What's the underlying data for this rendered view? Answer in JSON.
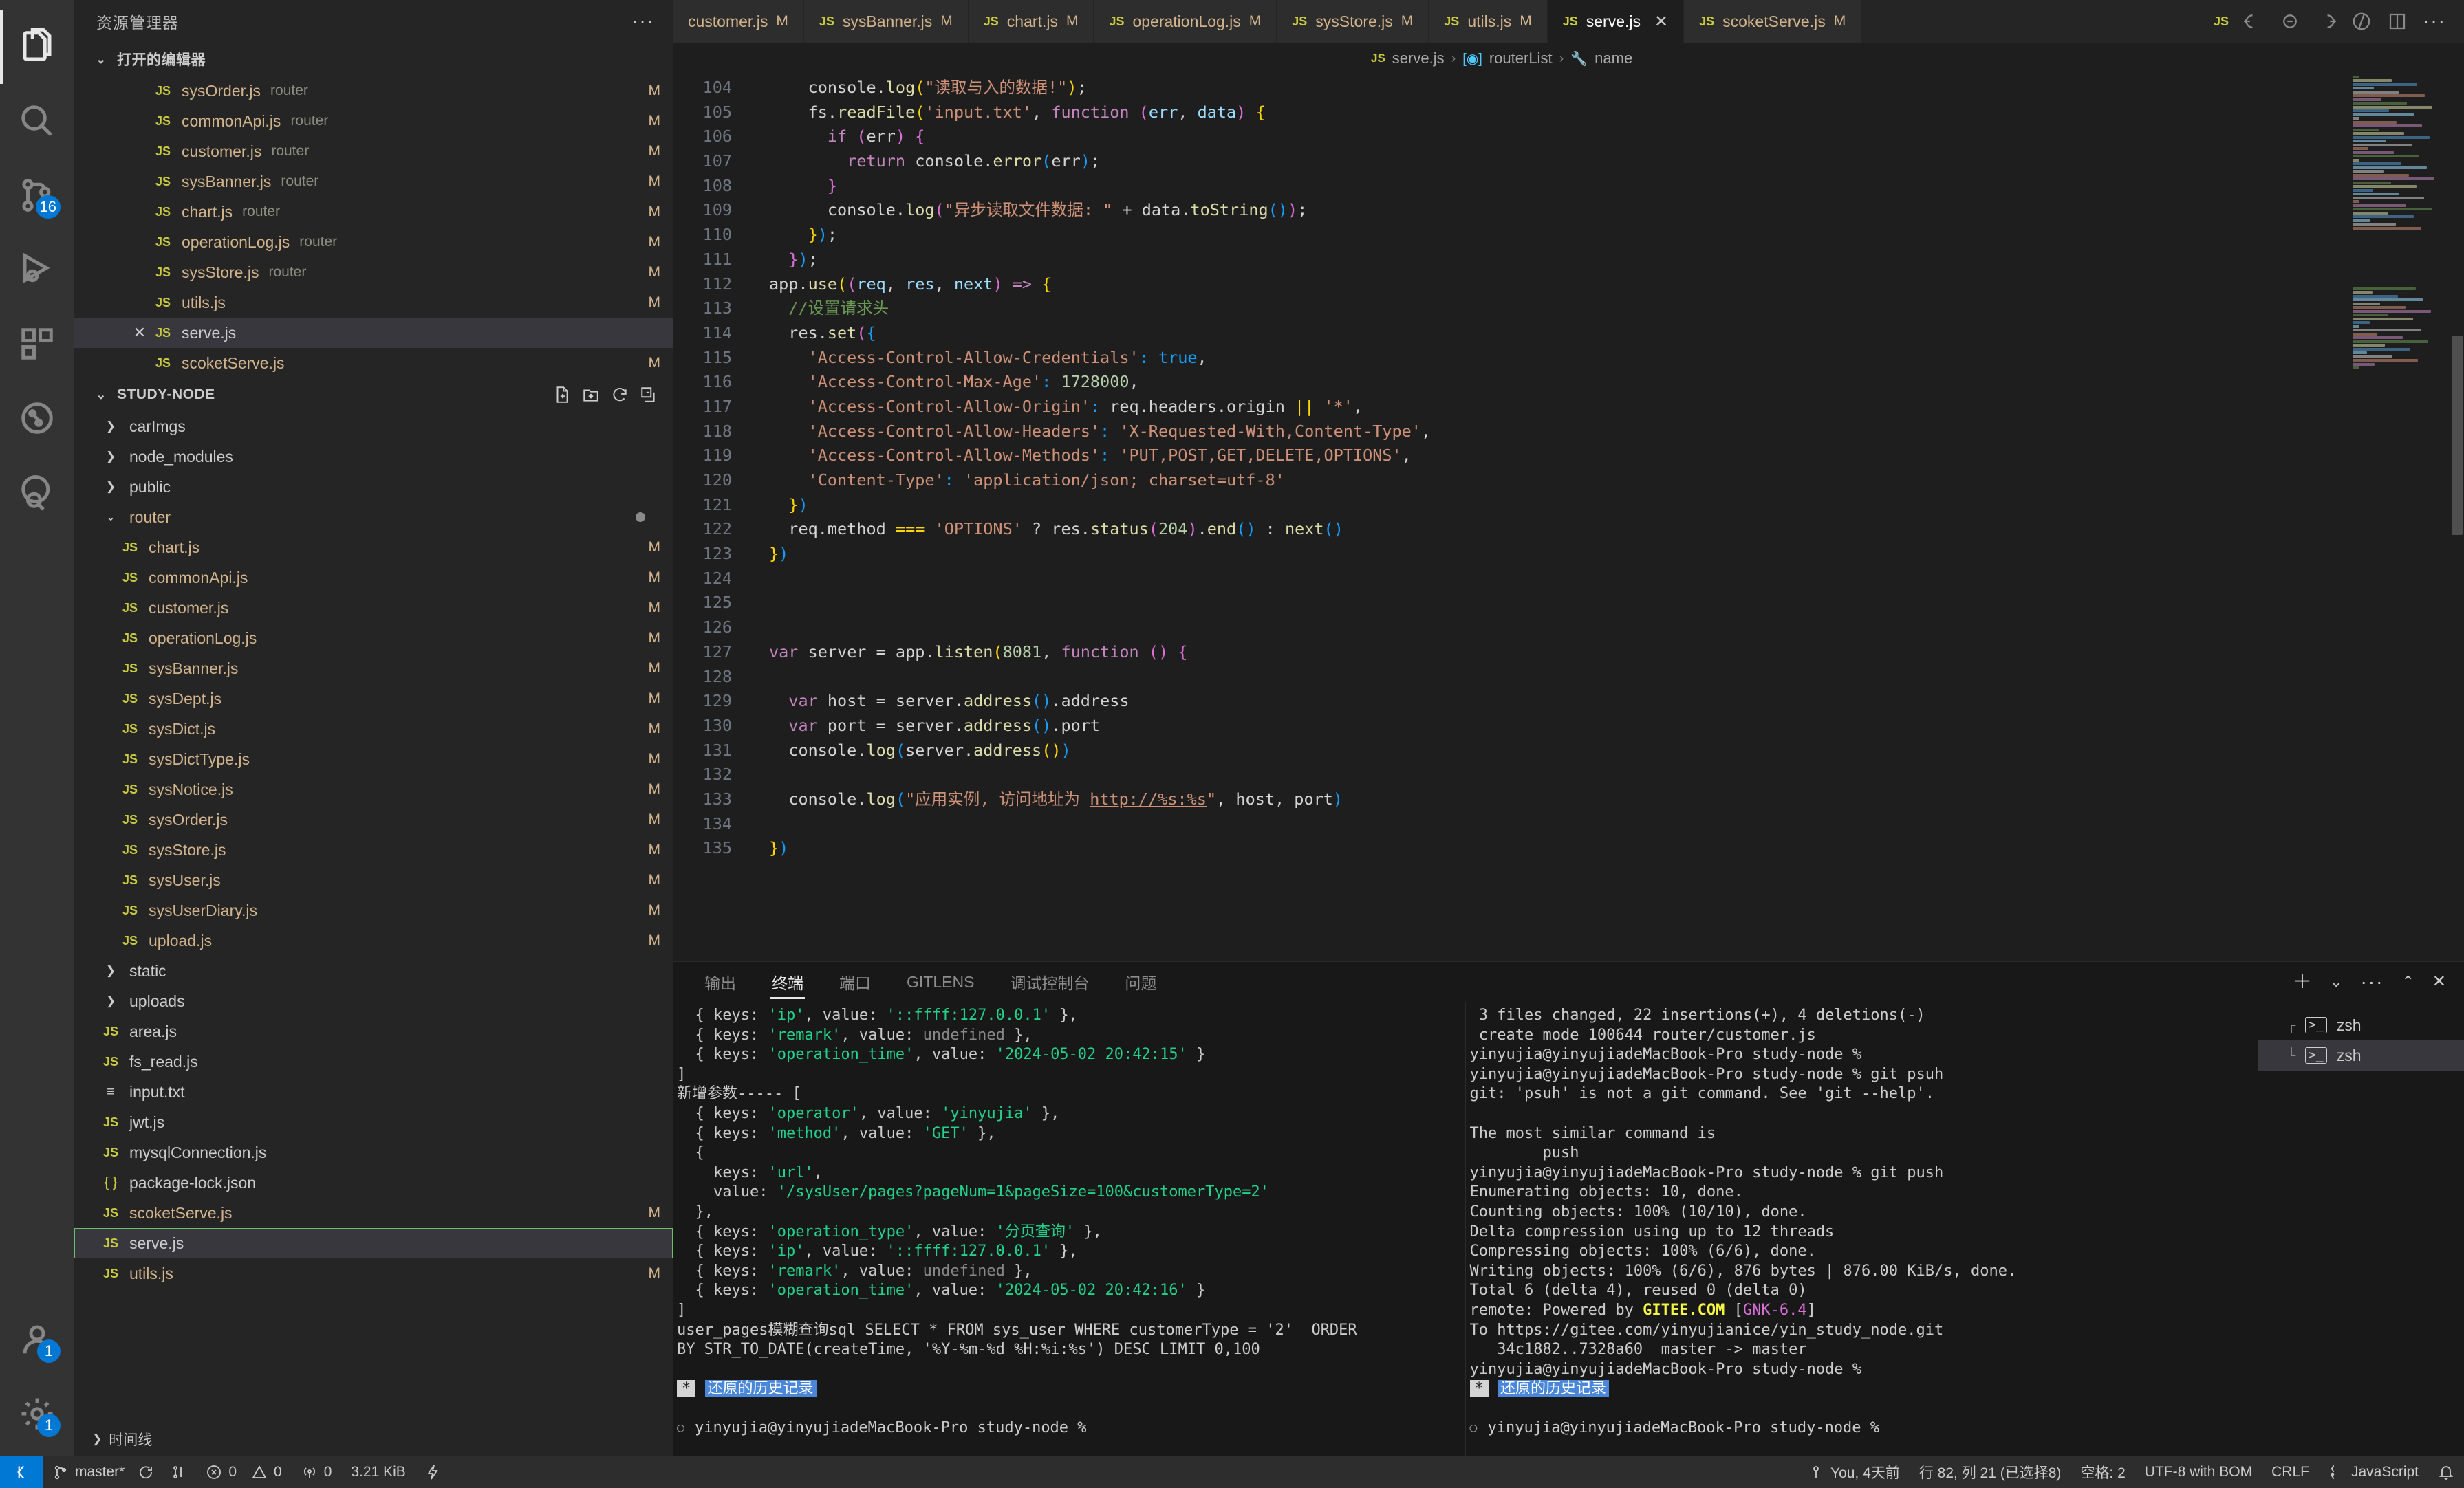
{
  "activity_bar": {
    "items": [
      {
        "name": "explorer",
        "icon": "files-icon",
        "active": true,
        "badge": null
      },
      {
        "name": "search",
        "icon": "search-icon",
        "active": false,
        "badge": null
      },
      {
        "name": "source-control",
        "icon": "source-control-icon",
        "active": false,
        "badge": "16"
      },
      {
        "name": "run-and-debug",
        "icon": "run-debug-icon",
        "active": false,
        "badge": null
      },
      {
        "name": "extensions",
        "icon": "extensions-icon",
        "active": false,
        "badge": null
      },
      {
        "name": "testing",
        "icon": "beaker-icon",
        "active": false,
        "badge": null
      },
      {
        "name": "gitlens",
        "icon": "gitlens-icon",
        "active": false,
        "badge": null
      }
    ],
    "bottom": [
      {
        "name": "accounts",
        "icon": "account-icon",
        "badge": "1"
      },
      {
        "name": "manage",
        "icon": "gear-icon",
        "badge": "1"
      }
    ]
  },
  "sidebar": {
    "title": "资源管理器",
    "more_label": "···",
    "open_editors": {
      "label": "打开的编辑器",
      "items": [
        {
          "name": "sysOrder.js",
          "desc": "router",
          "mod": "M",
          "active": false
        },
        {
          "name": "commonApi.js",
          "desc": "router",
          "mod": "M",
          "active": false
        },
        {
          "name": "customer.js",
          "desc": "router",
          "mod": "M",
          "active": false
        },
        {
          "name": "sysBanner.js",
          "desc": "router",
          "mod": "M",
          "active": false
        },
        {
          "name": "chart.js",
          "desc": "router",
          "mod": "M",
          "active": false
        },
        {
          "name": "operationLog.js",
          "desc": "router",
          "mod": "M",
          "active": false
        },
        {
          "name": "sysStore.js",
          "desc": "router",
          "mod": "M",
          "active": false
        },
        {
          "name": "utils.js",
          "desc": "",
          "mod": "M",
          "active": false
        },
        {
          "name": "serve.js",
          "desc": "",
          "mod": "",
          "active": true
        },
        {
          "name": "scoketServe.js",
          "desc": "",
          "mod": "M",
          "active": false
        }
      ]
    },
    "workspace": {
      "label": "STUDY-NODE",
      "actions": [
        "new-file-icon",
        "new-folder-icon",
        "refresh-icon",
        "collapse-all-icon"
      ],
      "tree": [
        {
          "type": "folder",
          "name": "carImgs",
          "expanded": false,
          "indent": 1,
          "mod": ""
        },
        {
          "type": "folder",
          "name": "node_modules",
          "expanded": false,
          "indent": 1,
          "mod": ""
        },
        {
          "type": "folder",
          "name": "public",
          "expanded": false,
          "indent": 1,
          "mod": ""
        },
        {
          "type": "folder",
          "name": "router",
          "expanded": true,
          "indent": 1,
          "mod": "",
          "dirty": true,
          "color": "mod-js"
        },
        {
          "type": "js",
          "name": "chart.js",
          "indent": 2,
          "mod": "M",
          "color": "mod-js"
        },
        {
          "type": "js",
          "name": "commonApi.js",
          "indent": 2,
          "mod": "M",
          "color": "mod-js"
        },
        {
          "type": "js",
          "name": "customer.js",
          "indent": 2,
          "mod": "M",
          "color": "mod-js"
        },
        {
          "type": "js",
          "name": "operationLog.js",
          "indent": 2,
          "mod": "M",
          "color": "mod-js"
        },
        {
          "type": "js",
          "name": "sysBanner.js",
          "indent": 2,
          "mod": "M",
          "color": "mod-js"
        },
        {
          "type": "js",
          "name": "sysDept.js",
          "indent": 2,
          "mod": "M",
          "color": "mod-js"
        },
        {
          "type": "js",
          "name": "sysDict.js",
          "indent": 2,
          "mod": "M",
          "color": "mod-js"
        },
        {
          "type": "js",
          "name": "sysDictType.js",
          "indent": 2,
          "mod": "M",
          "color": "mod-js"
        },
        {
          "type": "js",
          "name": "sysNotice.js",
          "indent": 2,
          "mod": "M",
          "color": "mod-js"
        },
        {
          "type": "js",
          "name": "sysOrder.js",
          "indent": 2,
          "mod": "M",
          "color": "mod-js"
        },
        {
          "type": "js",
          "name": "sysStore.js",
          "indent": 2,
          "mod": "M",
          "color": "mod-js"
        },
        {
          "type": "js",
          "name": "sysUser.js",
          "indent": 2,
          "mod": "M",
          "color": "mod-js"
        },
        {
          "type": "js",
          "name": "sysUserDiary.js",
          "indent": 2,
          "mod": "M",
          "color": "mod-js"
        },
        {
          "type": "js",
          "name": "upload.js",
          "indent": 2,
          "mod": "M",
          "color": "mod-js"
        },
        {
          "type": "folder",
          "name": "static",
          "expanded": false,
          "indent": 1,
          "mod": ""
        },
        {
          "type": "folder",
          "name": "uploads",
          "expanded": false,
          "indent": 1,
          "mod": ""
        },
        {
          "type": "js",
          "name": "area.js",
          "indent": 1,
          "mod": "",
          "color": "plain"
        },
        {
          "type": "js",
          "name": "fs_read.js",
          "indent": 1,
          "mod": "",
          "color": "plain"
        },
        {
          "type": "txt",
          "name": "input.txt",
          "indent": 1,
          "mod": "",
          "color": "plain"
        },
        {
          "type": "js",
          "name": "jwt.js",
          "indent": 1,
          "mod": "",
          "color": "plain"
        },
        {
          "type": "js",
          "name": "mysqlConnection.js",
          "indent": 1,
          "mod": "",
          "color": "plain"
        },
        {
          "type": "json",
          "name": "package-lock.json",
          "indent": 1,
          "mod": "",
          "color": "plain"
        },
        {
          "type": "js",
          "name": "scoketServe.js",
          "indent": 1,
          "mod": "M",
          "color": "mod-js"
        },
        {
          "type": "js",
          "name": "serve.js",
          "indent": 1,
          "mod": "",
          "color": "plain",
          "focused": true
        },
        {
          "type": "js",
          "name": "utils.js",
          "indent": 1,
          "mod": "M",
          "color": "mod-js"
        }
      ]
    },
    "timeline_label": "时间线"
  },
  "editor": {
    "tabs": [
      {
        "name": "customer.js",
        "mod": "M",
        "active": false,
        "show_icon": false
      },
      {
        "name": "sysBanner.js",
        "mod": "M",
        "active": false,
        "show_icon": true
      },
      {
        "name": "chart.js",
        "mod": "M",
        "active": false,
        "show_icon": true
      },
      {
        "name": "operationLog.js",
        "mod": "M",
        "active": false,
        "show_icon": true
      },
      {
        "name": "sysStore.js",
        "mod": "M",
        "active": false,
        "show_icon": true
      },
      {
        "name": "utils.js",
        "mod": "M",
        "active": false,
        "show_icon": true
      },
      {
        "name": "serve.js",
        "mod": "",
        "active": true,
        "show_icon": true,
        "close": "✕"
      },
      {
        "name": "scoketServe.js",
        "mod": "M",
        "active": false,
        "show_icon": true
      }
    ],
    "tab_actions": [
      "split-left-icon",
      "split-center-icon",
      "split-right-icon",
      "run-icon",
      "split-editor-icon",
      "more-icon"
    ],
    "breadcrumb": {
      "file": "serve.js",
      "symbol1": "routerList",
      "symbol2": "name",
      "separator": "›"
    },
    "code_lines": [
      {
        "n": 104,
        "html": "    console.<span class='fn'>log</span><span class='pp'>(</span><span class='st'>\"读取与入的数据!\"</span><span class='pp'>)</span>;"
      },
      {
        "n": 105,
        "html": "    fs.<span class='fn'>readFile</span><span class='pp'>(</span><span class='st'>'input.txt'</span>, <span class='kw'>function</span> <span class='p2'>(</span><span class='vr'>err</span>, <span class='vr'>data</span><span class='p2'>)</span> <span class='pp'>{</span>"
      },
      {
        "n": 106,
        "html": "      <span class='kw'>if</span> <span class='p2'>(</span>err<span class='p2'>)</span> <span class='p2'>{</span>"
      },
      {
        "n": 107,
        "html": "        <span class='kw'>return</span> console.<span class='fn'>error</span><span class='p3'>(</span>err<span class='p3'>)</span>;"
      },
      {
        "n": 108,
        "html": "      <span class='p2'>}</span>"
      },
      {
        "n": 109,
        "html": "      console.<span class='fn'>log</span><span class='p2'>(</span><span class='st'>\"异步读取文件数据: \"</span> + data.<span class='fn'>toString</span><span class='p3'>()</span><span class='p2'>)</span>;"
      },
      {
        "n": 110,
        "html": "    <span class='pp'>}</span><span class='p3'>)</span>;"
      },
      {
        "n": 111,
        "html": "  <span class='p2'>}</span><span class='p3'>)</span>;"
      },
      {
        "n": 112,
        "html": "app.<span class='fn'>use</span><span class='pp'>(</span><span class='p2'>(</span><span class='vr'>req</span>, <span class='vr'>res</span>, <span class='vr'>next</span><span class='p2'>)</span> <span class='kw'>=&gt;</span> <span class='pp'>{</span>"
      },
      {
        "n": 113,
        "html": "  <span class='cm'>//设置请求头</span>"
      },
      {
        "n": 114,
        "html": "  res.<span class='fn'>set</span><span class='p2'>(</span><span class='p3'>{</span>"
      },
      {
        "n": 115,
        "html": "    <span class='st'>'Access-Control-Allow-Credentials'</span><span class='p3'>:</span> <span class='p3'>true</span>,"
      },
      {
        "n": 116,
        "html": "    <span class='st'>'Access-Control-Max-Age'</span><span class='p3'>:</span> <span class='nm'>1728000</span>,"
      },
      {
        "n": 117,
        "html": "    <span class='st'>'Access-Control-Allow-Origin'</span><span class='p3'>:</span> req.headers.origin <span class='pp'>||</span> <span class='st'>'*'</span>,"
      },
      {
        "n": 118,
        "html": "    <span class='st'>'Access-Control-Allow-Headers'</span><span class='p3'>:</span> <span class='st'>'X-Requested-With,Content-Type'</span>,"
      },
      {
        "n": 119,
        "html": "    <span class='st'>'Access-Control-Allow-Methods'</span><span class='p3'>:</span> <span class='st'>'PUT,POST,GET,DELETE,OPTIONS'</span>,"
      },
      {
        "n": 120,
        "html": "    <span class='st'>'Content-Type'</span><span class='p3'>:</span> <span class='st'>'application/json; charset=utf-8'</span>"
      },
      {
        "n": 121,
        "html": "  <span class='pp'>}</span><span class='p3'>)</span>"
      },
      {
        "n": 122,
        "html": "  req.method <span class='pp'>===</span> <span class='st'>'OPTIONS'</span> ? res.<span class='fn'>status</span><span class='p2'>(</span><span class='nm'>204</span><span class='p2'>)</span>.<span class='fn'>end</span><span class='p3'>()</span> : <span class='fn'>next</span><span class='p3'>()</span>"
      },
      {
        "n": 123,
        "html": "<span class='pp'>}</span><span class='p3'>)</span>"
      },
      {
        "n": 124,
        "html": ""
      },
      {
        "n": 125,
        "html": ""
      },
      {
        "n": 126,
        "html": ""
      },
      {
        "n": 127,
        "html": "<span class='kw'>var</span> server = app.<span class='fn'>listen</span><span class='pp'>(</span><span class='nm'>8081</span>, <span class='kw'>function</span> <span class='p2'>()</span> <span class='p2'>{</span>"
      },
      {
        "n": 128,
        "html": ""
      },
      {
        "n": 129,
        "html": "  <span class='kw'>var</span> host = server.<span class='fn'>address</span><span class='p3'>()</span>.address"
      },
      {
        "n": 130,
        "html": "  <span class='kw'>var</span> port = server.<span class='fn'>address</span><span class='p3'>()</span>.port"
      },
      {
        "n": 131,
        "html": "  console.<span class='fn'>log</span><span class='p3'>(</span>server.<span class='fn'>address</span><span class='pp'>()</span><span class='p3'>)</span>"
      },
      {
        "n": 132,
        "html": ""
      },
      {
        "n": 133,
        "html": "  console.<span class='fn'>log</span><span class='p3'>(</span><span class='st'>\"应用实例, 访问地址为 </span><span class='lnk'>http://%s:%s</span><span class='st'>\"</span>, host, port<span class='p3'>)</span>"
      },
      {
        "n": 134,
        "html": ""
      },
      {
        "n": 135,
        "html": "<span class='pp'>}</span><span class='p3'>)</span>"
      }
    ]
  },
  "panel": {
    "tabs": [
      {
        "label": "输出",
        "active": false
      },
      {
        "label": "终端",
        "active": true
      },
      {
        "label": "端口",
        "active": false
      },
      {
        "label": "GITLENS",
        "active": false
      },
      {
        "label": "调试控制台",
        "active": false
      },
      {
        "label": "问题",
        "active": false
      }
    ],
    "actions": [
      "add-terminal-icon",
      "chevron-down-icon",
      "more-icon",
      "chevron-up-icon",
      "close-icon"
    ],
    "terminal_left_lines": [
      "  { keys: <span class='tg'>'ip'</span>, value: <span class='tg'>'::ffff:127.0.0.1'</span> },",
      "  { keys: <span class='tg'>'remark'</span>, value: <span class='tdim'>undefined</span> },",
      "  { keys: <span class='tg'>'operation_time'</span>, value: <span class='tg'>'2024-05-02 20:42:15'</span> }",
      "]",
      "新增参数----- [",
      "  { keys: <span class='tg'>'operator'</span>, value: <span class='tg'>'yinyujia'</span> },",
      "  { keys: <span class='tg'>'method'</span>, value: <span class='tg'>'GET'</span> },",
      "  {",
      "    keys: <span class='tg'>'url'</span>,",
      "    value: <span class='tg'>'/sysUser/pages?pageNum=1&amp;pageSize=100&amp;customerType=2'</span>",
      "  },",
      "  { keys: <span class='tg'>'operation_type'</span>, value: <span class='tg'>'分页查询'</span> },",
      "  { keys: <span class='tg'>'ip'</span>, value: <span class='tg'>'::ffff:127.0.0.1'</span> },",
      "  { keys: <span class='tg'>'remark'</span>, value: <span class='tdim'>undefined</span> },",
      "  { keys: <span class='tg'>'operation_time'</span>, value: <span class='tg'>'2024-05-02 20:42:16'</span> }",
      "]",
      "user_pages模糊查询sql SELECT * FROM sys_user WHERE customerType = '2'  ORDER",
      "BY STR_TO_DATE(createTime, '%Y-%m-%d %H:%i:%s') DESC LIMIT 0,100",
      "",
      "<span class='mark-ast'>*</span> <span class='mark-sel'>还原的历史记录</span>"
    ],
    "terminal_left_prompt": "yinyujia@yinyujiadeMacBook-Pro study-node %",
    "terminal_right_lines": [
      " 3 files changed, 22 insertions(+), 4 deletions(-)",
      " create mode 100644 router/customer.js",
      "yinyujia@yinyujiadeMacBook-Pro study-node %",
      "yinyujia@yinyujiadeMacBook-Pro study-node % git psuh",
      "git: 'psuh' is not a git command. See 'git --help'.",
      "",
      "The most similar command is",
      "        push",
      "yinyujia@yinyujiadeMacBook-Pro study-node % git push",
      "Enumerating objects: 10, done.",
      "Counting objects: 100% (10/10), done.",
      "Delta compression using up to 12 threads",
      "Compressing objects: 100% (6/6), done.",
      "Writing objects: 100% (6/6), 876 bytes | 876.00 KiB/s, done.",
      "Total 6 (delta 4), reused 0 (delta 0)",
      "remote: Powered by <span class='tyel'>GITEE.COM</span> [<span class='tmag'>GNK-6.4</span>]",
      "To https://gitee.com/yinyujianice/yin_study_node.git",
      "   34c1882..7328a60  master -&gt; master",
      "yinyujia@yinyujiadeMacBook-Pro study-node %",
      "<span class='mark-ast'>*</span> <span class='mark-sel'>还原的历史记录</span>"
    ],
    "terminal_right_prompt": "yinyujia@yinyujiadeMacBook-Pro study-node %",
    "terminal_list": [
      {
        "label": "zsh",
        "active": false
      },
      {
        "label": "zsh",
        "active": true
      }
    ]
  },
  "statusbar": {
    "remote_icon": "remote-window-icon",
    "branch": "master*",
    "sync_icon": "sync-icon",
    "branch_compare_icon": "branch-compare-icon",
    "errors": "0",
    "warnings": "0",
    "radio_tower": "0",
    "size": "3.21 KiB",
    "lightning_icon": "zap-icon",
    "right": {
      "blame": "You, 4天前",
      "cursor": "行 82, 列 21 (已选择8)",
      "spaces": "空格: 2",
      "encoding": "UTF-8 with BOM",
      "eol": "CRLF",
      "language": "JavaScript",
      "bell_icon": "bell-icon"
    }
  }
}
